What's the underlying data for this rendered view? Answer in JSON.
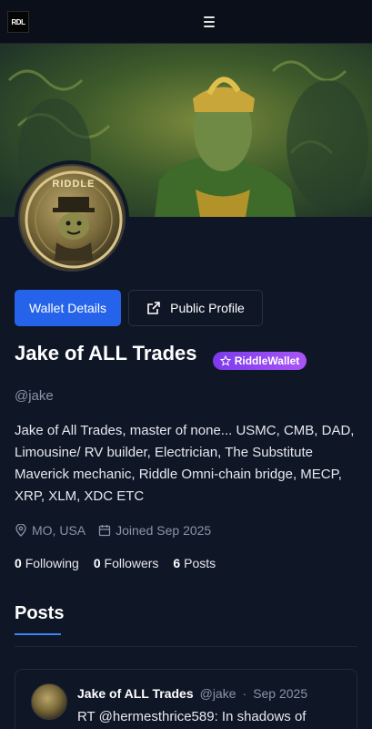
{
  "header": {
    "logo_text": "RDL",
    "menu_icon": "hamburger-icon"
  },
  "profile": {
    "avatar_logo_text": "RIDDLE",
    "buttons": {
      "wallet_details": "Wallet Details",
      "public_profile": "Public Profile"
    },
    "name": "Jake of ALL Trades",
    "badge": "RiddleWallet",
    "handle": "@jake",
    "bio": "Jake of All Trades, master of none... USMC, CMB, DAD, Limousine/ RV builder, Electrician, The Substitute Maverick mechanic, Riddle Omni-chain bridge, MECP, XRP, XLM, XDC ETC",
    "location": "MO, USA",
    "joined": "Joined Sep 2025",
    "stats": {
      "following_count": "0",
      "following_label": "Following",
      "followers_count": "0",
      "followers_label": "Followers",
      "posts_count": "6",
      "posts_label": "Posts"
    }
  },
  "posts_section": {
    "title": "Posts",
    "items": [
      {
        "author": "Jake of ALL Trades",
        "handle": "@jake",
        "separator": "·",
        "date": "Sep 2025",
        "text": "RT @hermesthrice589: In shadows of"
      }
    ]
  },
  "colors": {
    "accent": "#2563eb",
    "badge": "#a855f7",
    "background": "#0f1626"
  }
}
